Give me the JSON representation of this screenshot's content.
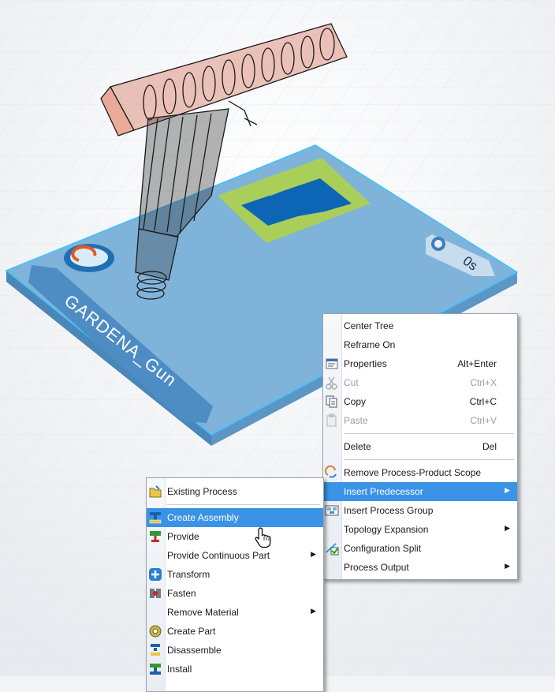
{
  "scene": {
    "part_name": "GARDENA_Gun",
    "timer": "0s"
  },
  "context_menu": {
    "items": [
      {
        "label": "Center Tree",
        "shortcut": "",
        "icon": ""
      },
      {
        "label": "Reframe On",
        "shortcut": "",
        "icon": ""
      },
      {
        "label": "Properties",
        "shortcut": "Alt+Enter",
        "icon": "properties-icon"
      },
      {
        "label": "Cut",
        "shortcut": "Ctrl+X",
        "icon": "scissors-icon"
      },
      {
        "label": "Copy",
        "shortcut": "Ctrl+C",
        "icon": "copy-icon"
      },
      {
        "label": "Paste",
        "shortcut": "Ctrl+V",
        "icon": "paste-icon"
      },
      {
        "label": "Delete",
        "shortcut": "Del",
        "icon": ""
      },
      {
        "label": "Remove Process-Product Scope",
        "shortcut": "",
        "icon": "remove-scope-icon"
      },
      {
        "label": "Insert Predecessor",
        "shortcut": "",
        "icon": ""
      },
      {
        "label": "Insert Process Group",
        "shortcut": "",
        "icon": "process-group-icon"
      },
      {
        "label": "Topology Expansion",
        "shortcut": "",
        "icon": ""
      },
      {
        "label": "Configuration Split",
        "shortcut": "",
        "icon": "configuration-split-icon"
      },
      {
        "label": "Process Output",
        "shortcut": "",
        "icon": ""
      }
    ]
  },
  "submenu": {
    "items": [
      {
        "label": "Existing Process",
        "icon": "existing-process-icon"
      },
      {
        "label": "Create Assembly",
        "icon": "create-assembly-icon"
      },
      {
        "label": "Provide",
        "icon": "provide-icon"
      },
      {
        "label": "Provide Continuous Part",
        "icon": ""
      },
      {
        "label": "Transform",
        "icon": "transform-icon"
      },
      {
        "label": "Fasten",
        "icon": "fasten-icon"
      },
      {
        "label": "Remove Material",
        "icon": ""
      },
      {
        "label": "Create Part",
        "icon": "create-part-icon"
      },
      {
        "label": "Disassemble",
        "icon": "disassemble-icon"
      },
      {
        "label": "Install",
        "icon": "install-icon"
      }
    ]
  },
  "colors": {
    "highlight": "#3b93e8",
    "plate": "#7aaed4",
    "accent_green": "#a9cf5a",
    "accent_blue": "#0c66b5"
  }
}
